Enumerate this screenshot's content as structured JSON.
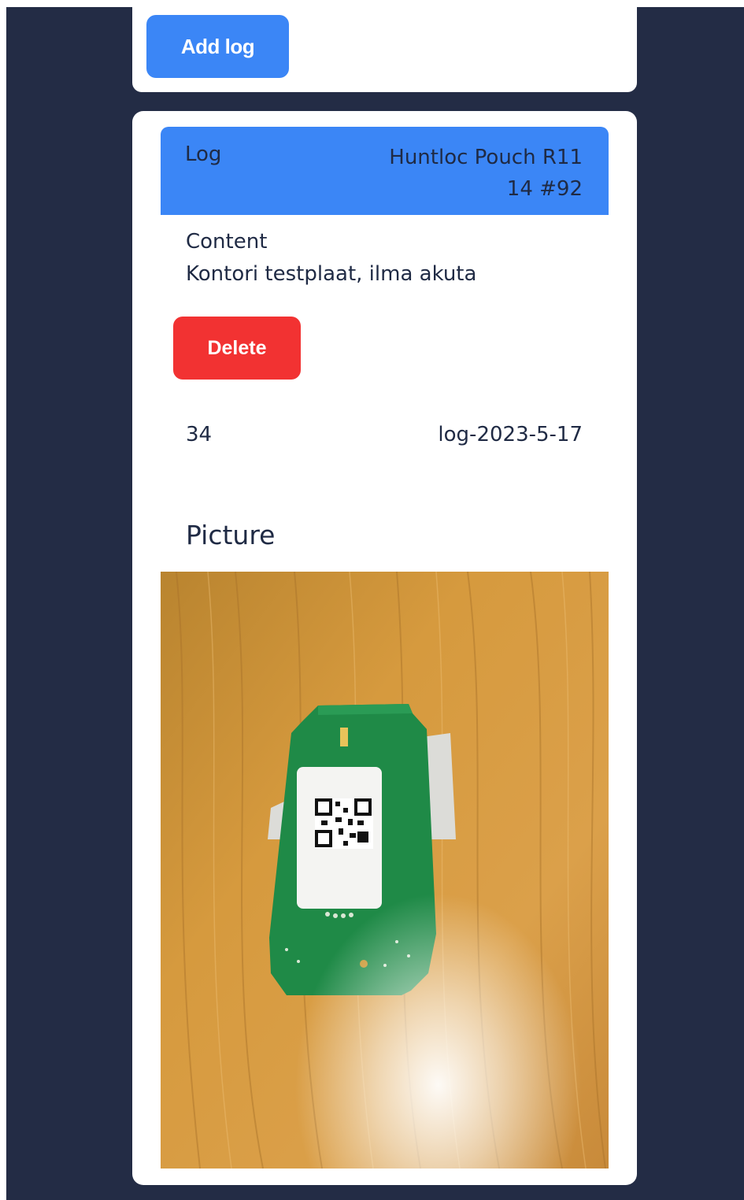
{
  "toolbar": {
    "add_log_label": "Add log"
  },
  "log": {
    "header_label": "Log",
    "device_name": "Huntloc Pouch R11 14 #92",
    "content_label": "Content",
    "content_text": "Kontori testplaat, ilma akuta",
    "delete_label": "Delete",
    "id": "34",
    "date": "log-2023-5-17",
    "picture_label": "Picture"
  },
  "colors": {
    "background": "#232c45",
    "accent": "#3b86f6",
    "danger": "#f23232",
    "text": "#1f2a44"
  }
}
